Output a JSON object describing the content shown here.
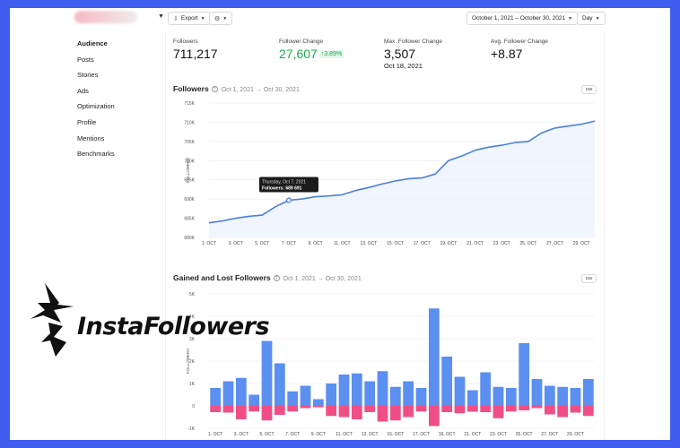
{
  "toolbar": {
    "export_label": "Export",
    "date_range": "October 1, 2021 – October 30, 2021",
    "granularity": "Day"
  },
  "sidebar": {
    "items": [
      {
        "label": "Audience",
        "active": true
      },
      {
        "label": "Posts"
      },
      {
        "label": "Stories"
      },
      {
        "label": "Ads"
      },
      {
        "label": "Optimization"
      },
      {
        "label": "Profile"
      },
      {
        "label": "Mentions"
      },
      {
        "label": "Benchmarks"
      }
    ]
  },
  "stats": {
    "followers": {
      "label": "Followers",
      "value": "711,217"
    },
    "change": {
      "label": "Follower Change",
      "value": "27,607",
      "pct": "↑3.89%"
    },
    "max_change": {
      "label": "Max. Follower Change",
      "value": "3,507",
      "date": "Oct 18, 2021"
    },
    "avg_change": {
      "label": "Avg. Follower Change",
      "value": "+8.87"
    }
  },
  "followers_section": {
    "title": "Followers",
    "range": "Oct 1, 2021 → Oct 30, 2021",
    "csv": "csv"
  },
  "gained_section": {
    "title": "Gained and Lost Followers",
    "range": "Oct 1, 2021 → Oct 30, 2021",
    "csv": "csv"
  },
  "tooltip": {
    "date": "Thursday, Oct 7, 2021",
    "value": "Followers: 689 691"
  },
  "logo": {
    "text": "InstaFollowers"
  },
  "colors": {
    "line": "#4a7fe0",
    "gain": "#5b8ff0",
    "loss": "#ef4f86",
    "green": "#1aa84c",
    "frame": "#3f5ef0"
  },
  "chart_data": [
    {
      "type": "area",
      "ylabel": "FOLLOWERS",
      "ylim": [
        680000,
        715000
      ],
      "yticks": [
        "715K",
        "710K",
        "705K",
        "700K",
        "695K",
        "690K",
        "685K",
        "680K"
      ],
      "xticks": [
        "1. OCT",
        "3. OCT",
        "5. OCT",
        "7. OCT",
        "9. OCT",
        "11. OCT",
        "13. OCT",
        "15. OCT",
        "17. OCT",
        "19. OCT",
        "21. OCT",
        "23. OCT",
        "25. OCT",
        "27. OCT",
        "29. OCT"
      ],
      "grid": true,
      "x": [
        1,
        2,
        3,
        4,
        5,
        6,
        7,
        8,
        9,
        10,
        11,
        12,
        13,
        14,
        15,
        16,
        17,
        18,
        19,
        20,
        21,
        22,
        23,
        24,
        25,
        26,
        27,
        28,
        29,
        30
      ],
      "values": [
        683800,
        684300,
        685000,
        685500,
        685800,
        688000,
        689691,
        690000,
        690600,
        690800,
        691100,
        692200,
        693000,
        693900,
        694700,
        695300,
        695500,
        696500,
        700000,
        701200,
        702700,
        703500,
        704000,
        704700,
        705000,
        707200,
        708500,
        709000,
        709500,
        710300
      ]
    },
    {
      "type": "bar",
      "ylabel": "FOLLOWERS",
      "ylim": [
        -1000,
        5000
      ],
      "yticks": [
        "5K",
        "4K",
        "3K",
        "2K",
        "1K",
        "0",
        "-1K"
      ],
      "xticks": [
        "1. OCT",
        "3. OCT",
        "5. OCT",
        "7. OCT",
        "9. OCT",
        "11. OCT",
        "13. OCT",
        "15. OCT",
        "17. OCT",
        "19. OCT",
        "21. OCT",
        "23. OCT",
        "25. OCT",
        "27. OCT",
        "29. OCT"
      ],
      "grid": true,
      "x": [
        1,
        2,
        3,
        4,
        5,
        6,
        7,
        8,
        9,
        10,
        11,
        12,
        13,
        14,
        15,
        16,
        17,
        18,
        19,
        20,
        21,
        22,
        23,
        24,
        25,
        26,
        27,
        28,
        29,
        30
      ],
      "series": [
        {
          "values": [
            800,
            1100,
            1250,
            500,
            2900,
            1900,
            650,
            900,
            300,
            1000,
            1400,
            1450,
            1100,
            1550,
            850,
            1100,
            800,
            4350,
            2200,
            1300,
            700,
            1500,
            850,
            800,
            2800,
            1200,
            900,
            850,
            800,
            1200
          ]
        },
        {
          "values": [
            -280,
            -300,
            -600,
            -250,
            -650,
            -400,
            -250,
            -100,
            -60,
            -450,
            -500,
            -600,
            -280,
            -700,
            -650,
            -500,
            -250,
            -900,
            -280,
            -330,
            -260,
            -280,
            -550,
            -250,
            -200,
            -100,
            -380,
            -500,
            -300,
            -450
          ]
        }
      ]
    }
  ]
}
